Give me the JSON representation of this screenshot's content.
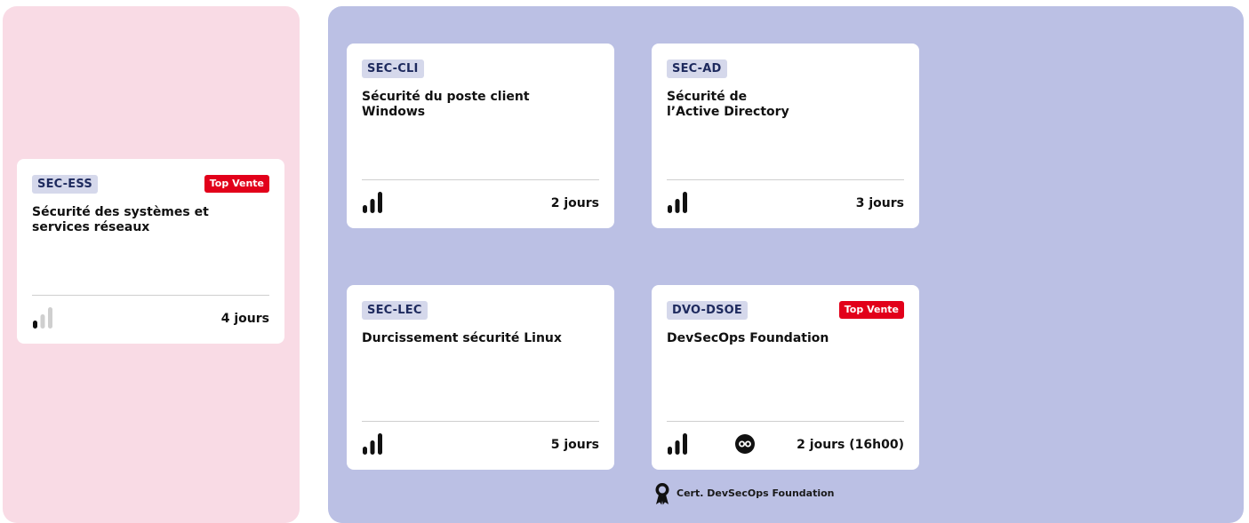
{
  "colors": {
    "left_panel": "#f9dbe5",
    "right_panel": "#bbc0e4",
    "code_badge_bg": "#d5d8eb",
    "top_vente": "#e2001a"
  },
  "courses": [
    {
      "code": "SEC-ESS",
      "badge": "Top Vente",
      "title": "Sécurité des systèmes et services réseaux",
      "level": 1,
      "level_max": 3,
      "duration": "4 jours"
    },
    {
      "code": "SEC-CLI",
      "badge": "",
      "title": "Sécurité du poste client Windows",
      "level": 3,
      "level_max": 3,
      "duration": "2 jours"
    },
    {
      "code": "SEC-AD",
      "badge": "",
      "title": "Sécurité de l’Active Directory",
      "level": 3,
      "level_max": 3,
      "duration": "3 jours"
    },
    {
      "code": "SEC-LEC",
      "badge": "",
      "title": "Durcissement sécurité Linux",
      "level": 3,
      "level_max": 3,
      "duration": "5 jours"
    },
    {
      "code": "DVO-DSOE",
      "badge": "Top Vente",
      "title": "DevSecOps Foundation",
      "level": 3,
      "level_max": 3,
      "extra_icon": "co-badge-icon",
      "duration": "2 jours (16h00)"
    }
  ],
  "certification": {
    "icon": "award-ribbon-icon",
    "label": "Cert. DevSecOps Foundation"
  }
}
